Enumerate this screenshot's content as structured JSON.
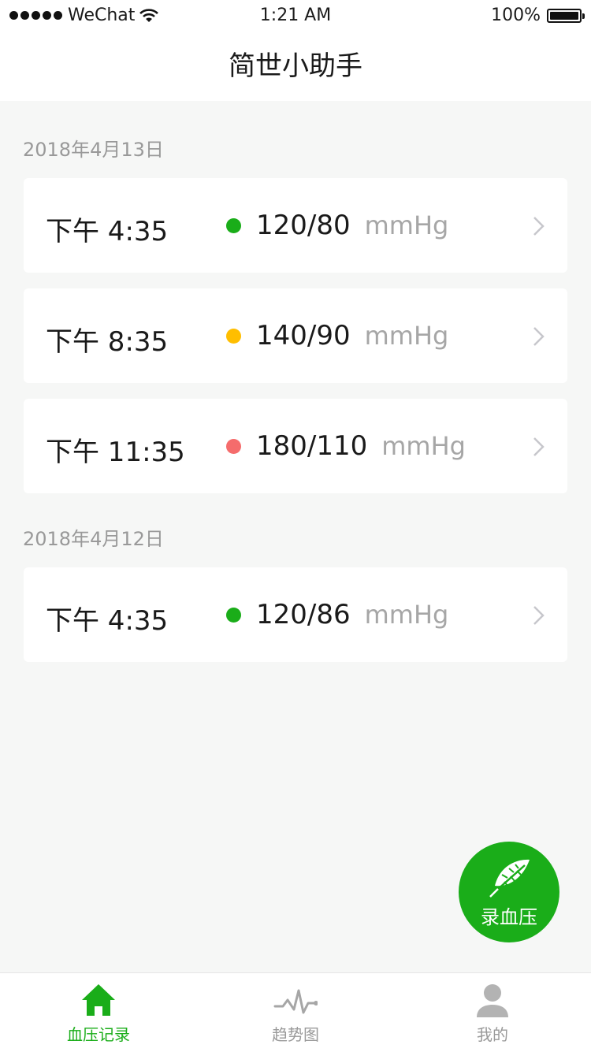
{
  "status_bar": {
    "carrier": "WeChat",
    "time": "1:21 AM",
    "battery": "100%"
  },
  "nav": {
    "title": "简世小助手"
  },
  "sections": [
    {
      "date": "2018年4月13日",
      "records": [
        {
          "time": "下午 4:35",
          "value": "120/80",
          "unit": "mmHg",
          "status_color": "#1aad19"
        },
        {
          "time": "下午 8:35",
          "value": "140/90",
          "unit": "mmHg",
          "status_color": "#ffbe00"
        },
        {
          "time": "下午 11:35",
          "value": "180/110",
          "unit": "mmHg",
          "status_color": "#f56c6c"
        }
      ]
    },
    {
      "date": "2018年4月12日",
      "records": [
        {
          "time": "下午 4:35",
          "value": "120/86",
          "unit": "mmHg",
          "status_color": "#1aad19"
        }
      ]
    }
  ],
  "fab": {
    "label": "录血压",
    "icon": "feather-icon"
  },
  "tabbar": {
    "tabs": [
      {
        "label": "血压记录",
        "icon": "home-icon",
        "active": true
      },
      {
        "label": "趋势图",
        "icon": "pulse-chart-icon",
        "active": false
      },
      {
        "label": "我的",
        "icon": "user-icon",
        "active": false
      }
    ]
  },
  "colors": {
    "accent": "#1aad19",
    "background": "#f6f7f6",
    "muted": "#999999"
  }
}
